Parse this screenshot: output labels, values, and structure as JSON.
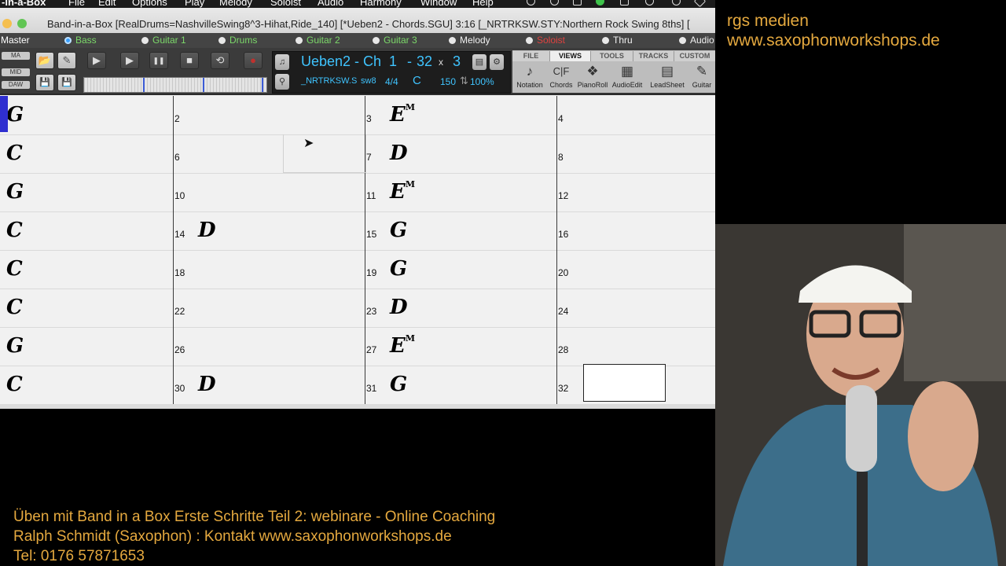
{
  "menubar": {
    "items": [
      "-in-a-Box",
      "File",
      "Edit",
      "Options",
      "Play",
      "Melody",
      "Soloist",
      "Audio",
      "Harmony",
      "Window",
      "Help"
    ],
    "system_icons": [
      "creative-cloud-icon",
      "eye-icon",
      "camera-icon",
      "check-icon",
      "pen-icon",
      "clock-icon",
      "bluetooth-icon",
      "heart-icon"
    ]
  },
  "window": {
    "title": "Band-in-a-Box [RealDrums=NashvilleSwing8^3-Hihat,Ride_140] [*Ueben2 - Chords.SGU]  3:16  [_NRTRKSW.STY:Northern Rock Swing 8ths] ["
  },
  "tracks": [
    {
      "label": "Master",
      "style": "master",
      "dot": false
    },
    {
      "label": "Bass",
      "style": "green",
      "dot": true,
      "dot_style": "blue"
    },
    {
      "label": "Guitar 1",
      "style": "green",
      "dot": true
    },
    {
      "label": "Drums",
      "style": "green",
      "dot": true
    },
    {
      "label": "Guitar 2",
      "style": "green",
      "dot": true
    },
    {
      "label": "Guitar 3",
      "style": "green",
      "dot": true
    },
    {
      "label": "Melody",
      "style": "white",
      "dot": true
    },
    {
      "label": "Soloist",
      "style": "red",
      "dot": true
    },
    {
      "label": "Thru",
      "style": "white",
      "dot": true
    },
    {
      "label": "Audio",
      "style": "white",
      "dot": true
    }
  ],
  "toolbar": {
    "side_buttons": [
      "MA",
      "MID",
      "DAW"
    ],
    "transport": {
      "open": "📂",
      "edit": "✎",
      "play": "▶",
      "play_from": "▶",
      "pause": "❚❚",
      "stop": "■",
      "loop": "⟲",
      "record": "●",
      "save": "💾",
      "save_as": "💾"
    },
    "song_title": "Ueben2 - Ch",
    "position": "1",
    "separator": "-",
    "bars": "32",
    "x": "x",
    "choruses": "3",
    "style_name": "_NRTRKSW.S",
    "feel": "sw8",
    "time_sig": "4/4",
    "key": "C",
    "tempo": "150",
    "tempo_arrows": "⇅",
    "volume": "100%"
  },
  "views": {
    "tabs": [
      "FILE",
      "VIEWS",
      "TOOLS",
      "TRACKS",
      "CUSTOM"
    ],
    "active_tab": "VIEWS",
    "buttons": [
      {
        "label": "Notation",
        "icon": "♪"
      },
      {
        "label": "Chords",
        "icon": "C|F"
      },
      {
        "label": "PianoRoll",
        "icon": "❖"
      },
      {
        "label": "AudioEdit",
        "icon": "▦"
      },
      {
        "label": "LeadSheet",
        "icon": "▤"
      },
      {
        "label": "Guitar",
        "icon": "✎"
      }
    ]
  },
  "sheet": {
    "rows": [
      {
        "cells": [
          {
            "bar": "",
            "chord": "G",
            "ext": ""
          },
          {
            "bar": "2",
            "chord": "",
            "ext": ""
          },
          {
            "bar": "3",
            "chord": "E",
            "ext": "M"
          },
          {
            "bar": "4",
            "chord": "",
            "ext": ""
          }
        ]
      },
      {
        "cells": [
          {
            "bar": "",
            "chord": "C",
            "ext": ""
          },
          {
            "bar": "6",
            "chord": "",
            "ext": ""
          },
          {
            "bar": "7",
            "chord": "D",
            "ext": ""
          },
          {
            "bar": "8",
            "chord": "",
            "ext": ""
          }
        ]
      },
      {
        "cells": [
          {
            "bar": "",
            "chord": "G",
            "ext": ""
          },
          {
            "bar": "10",
            "chord": "",
            "ext": ""
          },
          {
            "bar": "11",
            "chord": "E",
            "ext": "M"
          },
          {
            "bar": "12",
            "chord": "",
            "ext": ""
          }
        ]
      },
      {
        "cells": [
          {
            "bar": "",
            "chord": "C",
            "ext": ""
          },
          {
            "bar": "14",
            "chord": "D",
            "ext": ""
          },
          {
            "bar": "15",
            "chord": "G",
            "ext": ""
          },
          {
            "bar": "16",
            "chord": "",
            "ext": ""
          }
        ]
      },
      {
        "cells": [
          {
            "bar": "",
            "chord": "C",
            "ext": ""
          },
          {
            "bar": "18",
            "chord": "",
            "ext": ""
          },
          {
            "bar": "19",
            "chord": "G",
            "ext": ""
          },
          {
            "bar": "20",
            "chord": "",
            "ext": ""
          }
        ]
      },
      {
        "cells": [
          {
            "bar": "",
            "chord": "C",
            "ext": ""
          },
          {
            "bar": "22",
            "chord": "",
            "ext": ""
          },
          {
            "bar": "23",
            "chord": "D",
            "ext": ""
          },
          {
            "bar": "24",
            "chord": "",
            "ext": ""
          }
        ]
      },
      {
        "cells": [
          {
            "bar": "",
            "chord": "G",
            "ext": ""
          },
          {
            "bar": "26",
            "chord": "",
            "ext": ""
          },
          {
            "bar": "27",
            "chord": "E",
            "ext": "M"
          },
          {
            "bar": "28",
            "chord": "",
            "ext": ""
          }
        ]
      },
      {
        "cells": [
          {
            "bar": "",
            "chord": "C",
            "ext": ""
          },
          {
            "bar": "30",
            "chord": "D",
            "ext": ""
          },
          {
            "bar": "31",
            "chord": "G",
            "ext": ""
          },
          {
            "bar": "32",
            "chord": "",
            "ext": ""
          }
        ]
      }
    ]
  },
  "overlay": {
    "brand_line1": "rgs medien",
    "brand_line2": "www.saxophonworkshops.de",
    "caption_line1": "Üben mit Band in a Box Erste Schritte Teil 2: webinare - Online Coaching",
    "caption_line2": "Ralph Schmidt (Saxophon) : Kontakt www.saxophonworkshops.de",
    "caption_line3": "Tel: 0176 57871653",
    "colors": {
      "accent": "#e5a93f",
      "lcd_text": "#3fc4ff",
      "track_green": "#7cd96a",
      "soloist_red": "#e0423f"
    }
  }
}
